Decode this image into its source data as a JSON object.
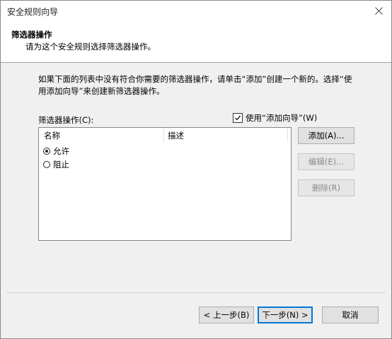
{
  "window": {
    "title": "安全规则向导",
    "close_glyph": "✕"
  },
  "header": {
    "title": "筛选器操作",
    "subtitle": "请为这个安全规则选择筛选器操作。"
  },
  "description": "如果下面的列表中没有符合你需要的筛选器操作，请单击“添加”创建一个新的。选择“使用添加向导”来创建新筛选器操作。",
  "list": {
    "label": "筛选器操作(C):",
    "use_wizard_label": "使用“添加向导”(W)",
    "use_wizard_checked": true,
    "columns": [
      "名称",
      "描述"
    ],
    "rows": [
      {
        "name": "允许",
        "description": "",
        "selected": true
      },
      {
        "name": "阻止",
        "description": "",
        "selected": false
      }
    ]
  },
  "side_buttons": {
    "add": "添加(A)...",
    "edit": "编辑(E)...",
    "delete": "删除(R)"
  },
  "footer": {
    "back": "< 上一步(B)",
    "next": "下一步(N) >",
    "cancel": "取消"
  }
}
